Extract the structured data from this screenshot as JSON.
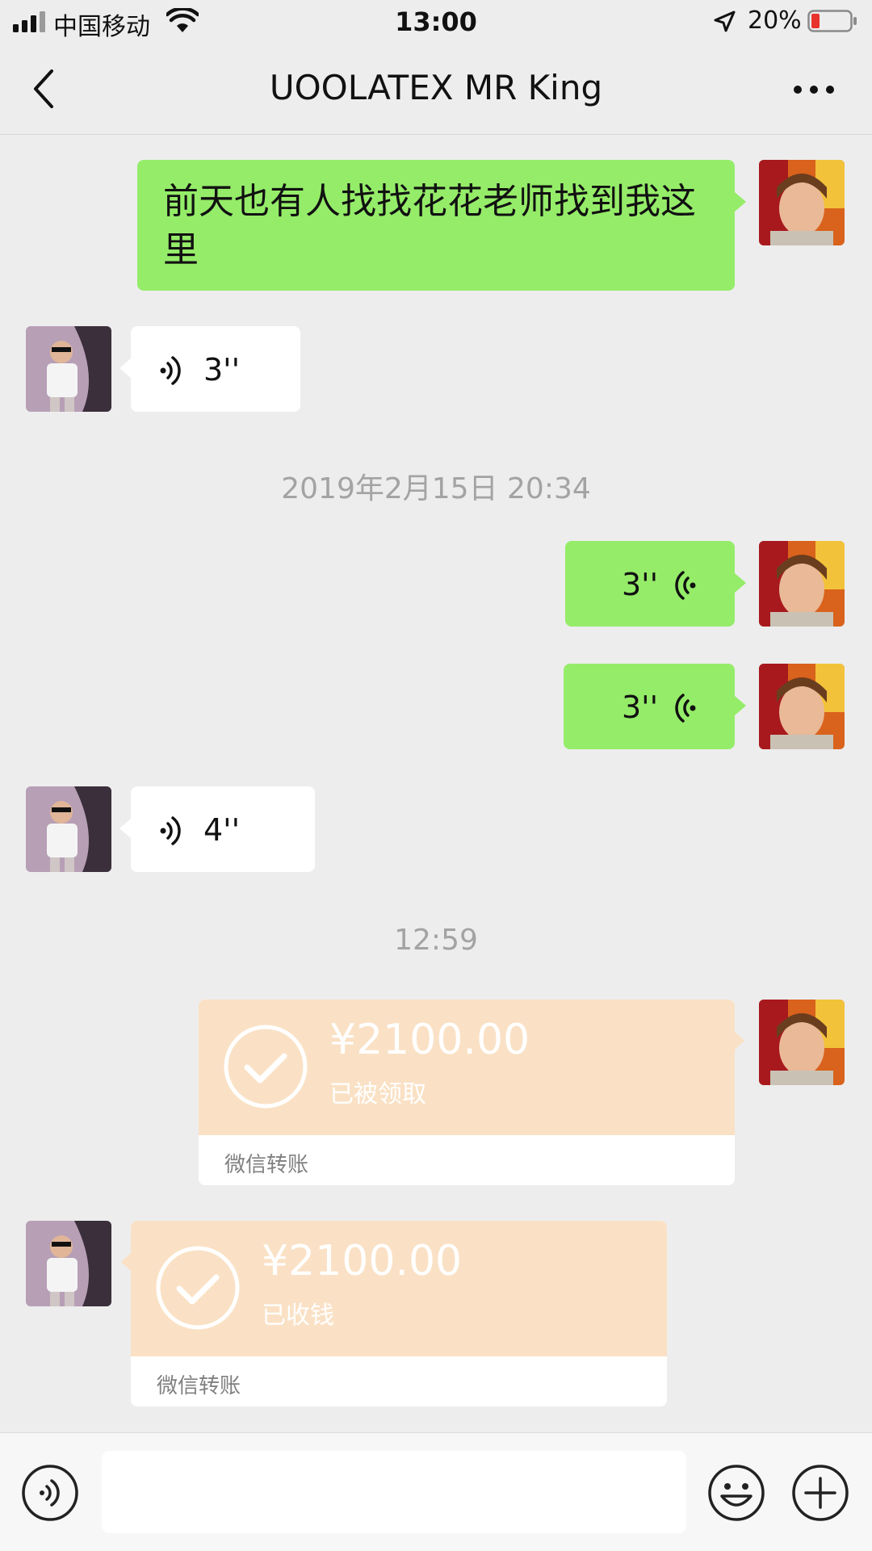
{
  "status_bar": {
    "carrier": "中国移动",
    "time": "13:00",
    "battery": "20%"
  },
  "nav": {
    "title": "UOOLATEX  MR King"
  },
  "messages": [
    {
      "type": "text",
      "side": "right",
      "text": "前天也有人找找花花老师找到我这里"
    },
    {
      "type": "voice",
      "side": "left",
      "duration": "3''"
    },
    {
      "type": "timestamp",
      "text": "2019年2月15日 20:34"
    },
    {
      "type": "voice",
      "side": "right",
      "duration": "3''"
    },
    {
      "type": "voice",
      "side": "right",
      "duration": "3''"
    },
    {
      "type": "voice",
      "side": "left",
      "duration": "4''"
    },
    {
      "type": "timestamp",
      "text": "12:59"
    },
    {
      "type": "transfer",
      "side": "right",
      "amount": "¥2100.00",
      "status": "已被领取",
      "footer": "微信转账"
    },
    {
      "type": "transfer",
      "side": "left",
      "amount": "¥2100.00",
      "status": "已收钱",
      "footer": "微信转账"
    }
  ],
  "icons": {
    "back": "chevron-left-icon",
    "more": "more-icon",
    "voice_input": "voice-icon",
    "emoji": "emoji-icon",
    "plus": "plus-icon"
  },
  "colors": {
    "background": "#ededed",
    "sent_bubble": "#95ec69",
    "received_bubble": "#ffffff",
    "transfer_card": "#fae1c5"
  }
}
